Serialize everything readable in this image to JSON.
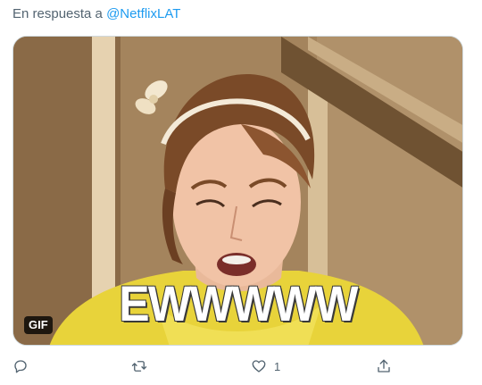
{
  "reply": {
    "prefix": "En respuesta a",
    "handle": "@NetflixLAT"
  },
  "media": {
    "caption": "EWWWWW",
    "badge": "GIF"
  },
  "actions": {
    "reply_icon": "reply-icon",
    "retweet_icon": "retweet-icon",
    "like_icon": "heart-icon",
    "like_count": "1",
    "share_icon": "share-icon"
  },
  "colors": {
    "muted": "#536471",
    "link": "#1d9bf0"
  }
}
